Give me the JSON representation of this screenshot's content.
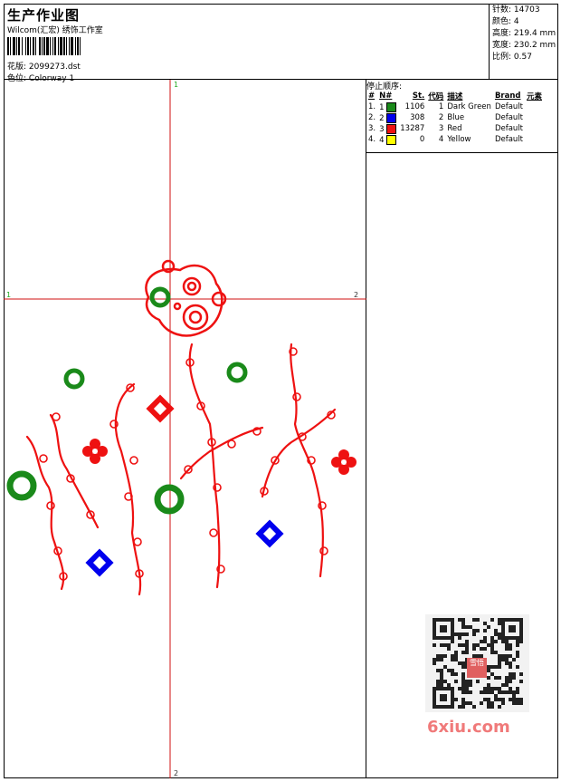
{
  "header": {
    "title": "生产作业图",
    "studio": "Wilcom(汇宏) 绣饰工作室",
    "file_label": "花版:",
    "file_name": "2099273.dst",
    "color_label": "色位:",
    "colorway": "Colorway 1"
  },
  "stats": [
    {
      "label": "针数:",
      "value": "14703"
    },
    {
      "label": "颜色:",
      "value": "4"
    },
    {
      "label": "高度:",
      "value": "219.4 mm"
    },
    {
      "label": "宽度:",
      "value": "230.2 mm"
    },
    {
      "label": "比例:",
      "value": "0.57"
    }
  ],
  "stop_sequence": {
    "caption": "停止顺序:",
    "columns": [
      "#",
      "N#",
      "St.",
      "代码",
      "描述",
      "Brand",
      "元素"
    ],
    "rows": [
      {
        "idx": "1.",
        "n": "1",
        "color": "#1a8a1a",
        "stitches": "1106",
        "code": "1",
        "desc": "Dark Green",
        "brand": "Default"
      },
      {
        "idx": "2.",
        "n": "2",
        "color": "#0000ee",
        "stitches": "308",
        "code": "2",
        "desc": "Blue",
        "brand": "Default"
      },
      {
        "idx": "3.",
        "n": "3",
        "color": "#ee1111",
        "stitches": "13287",
        "code": "3",
        "desc": "Red",
        "brand": "Default"
      },
      {
        "idx": "4.",
        "n": "4",
        "color": "#ffff00",
        "stitches": "0",
        "code": "4",
        "desc": "Yellow",
        "brand": "Default"
      }
    ]
  },
  "axes": {
    "top": "1",
    "left": "1",
    "right": "2",
    "bottom": "2"
  },
  "watermark": {
    "text": "6xiu.com",
    "seal": "雪悟"
  },
  "colors": {
    "green": "#1a8a1a",
    "blue": "#0000ee",
    "red": "#ee1111",
    "axis": "#d01010",
    "axis_label": "#22aa22"
  }
}
